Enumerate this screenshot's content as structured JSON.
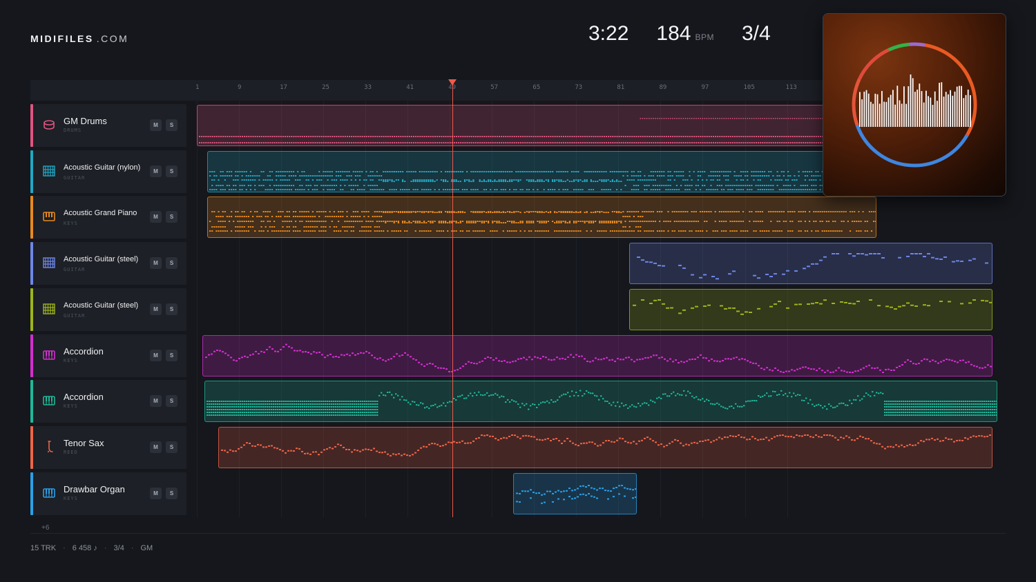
{
  "brand": {
    "name": "MIDIFILES",
    "suffix": ".COM"
  },
  "stats": {
    "duration": "3:22",
    "bpm": "184",
    "bpm_unit": "BPM",
    "time_signature": "3/4"
  },
  "ruler": {
    "ticks": [
      "1",
      "9",
      "17",
      "25",
      "33",
      "41",
      "49",
      "57",
      "65",
      "73",
      "81",
      "89",
      "97",
      "105",
      "113"
    ]
  },
  "playhead_bar": 49,
  "tracks": [
    {
      "name": "GM Drums",
      "category": "DRUMS",
      "color": "#e0557f",
      "icon": "drum-icon",
      "mute": "M",
      "solo": "S"
    },
    {
      "name": "Acoustic Guitar (nylon)",
      "category": "GUITAR",
      "color": "#21a7c4",
      "icon": "guitar-icon",
      "mute": "M",
      "solo": "S"
    },
    {
      "name": "Acoustic Grand Piano",
      "category": "KEYS",
      "color": "#e8891e",
      "icon": "piano-icon",
      "mute": "M",
      "solo": "S"
    },
    {
      "name": "Acoustic Guitar (steel)",
      "category": "GUITAR",
      "color": "#6f86e8",
      "icon": "guitar-icon",
      "mute": "M",
      "solo": "S"
    },
    {
      "name": "Acoustic Guitar (steel)",
      "category": "GUITAR",
      "color": "#9eb51b",
      "icon": "guitar-icon",
      "mute": "M",
      "solo": "S"
    },
    {
      "name": "Accordion",
      "category": "KEYS",
      "color": "#d42ed0",
      "icon": "keyboard-icon",
      "mute": "M",
      "solo": "S"
    },
    {
      "name": "Accordion",
      "category": "KEYS",
      "color": "#1fb89a",
      "icon": "keyboard-icon",
      "mute": "M",
      "solo": "S"
    },
    {
      "name": "Tenor Sax",
      "category": "REED",
      "color": "#ee6448",
      "icon": "sax-icon",
      "mute": "M",
      "solo": "S"
    },
    {
      "name": "Drawbar Organ",
      "category": "KEYS",
      "color": "#2aa0e8",
      "icon": "keyboard-icon",
      "mute": "M",
      "solo": "S"
    }
  ],
  "more_tracks": "+6",
  "footer": {
    "tracks": "15 TRK",
    "notes": "6 458 ♪",
    "time_signature": "3/4",
    "standard": "GM"
  }
}
